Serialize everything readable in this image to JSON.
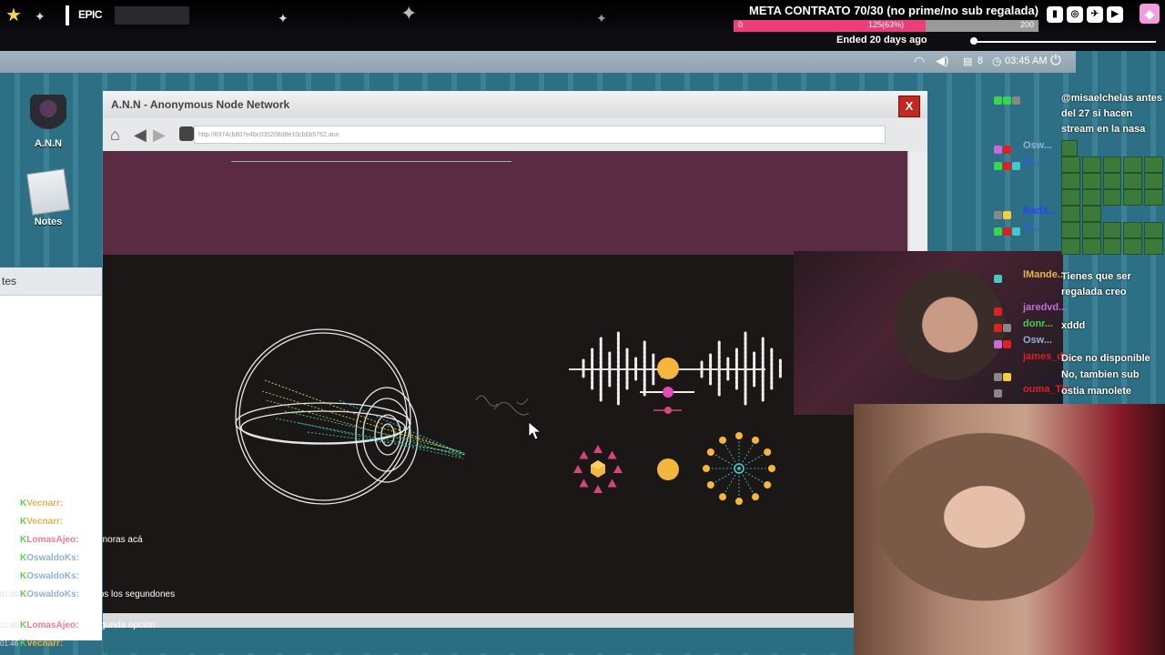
{
  "overlay": {
    "epic_label": "EPIC",
    "goal": {
      "title": "META CONTRATO 70/30 (no prime/no sub regalada)",
      "min": "0",
      "max": "200",
      "center": "125(63%)",
      "progress": 0.63,
      "fill_color": "#ec3f7a"
    },
    "ended": "Ended 20 days ago",
    "social_icons": [
      "twitch-icon",
      "instagram-icon",
      "twitter-icon",
      "youtube-icon"
    ],
    "gem_icon": "gem-icon"
  },
  "taskbar": {
    "badge": "8",
    "clock": "03:45 AM"
  },
  "desktop": {
    "icons": [
      {
        "label": "A.N.N",
        "icon": "hacker-icon"
      },
      {
        "label": "Notes",
        "icon": "notes-icon"
      }
    ],
    "notes_panel_title": "tes"
  },
  "ann": {
    "title": "A.N.N - Anonymous Node Network",
    "close": "X",
    "url": "http://6974cb807e4bc035208d8e10cb6b5762.ann"
  },
  "chat_right": [
    {
      "user": "",
      "user_color": "#3bd44f",
      "message": "@misaelchelas antes del 27 si hacen stream en la nasa"
    },
    {
      "user": "Osw...",
      "user_color": "#8fb2d6",
      "message": ""
    },
    {
      "user": "Ni...",
      "user_color": "#2f5fd8",
      "message": ""
    },
    {
      "user": "BadX...",
      "user_color": "#2a44ff",
      "message": ""
    },
    {
      "user": "Ni...",
      "user_color": "#2f5fd8",
      "message": ""
    },
    {
      "user": "lMande...",
      "user_color": "#e8b24a",
      "message": "Tienes que ser regalada creo"
    },
    {
      "user": "jaredvd...",
      "user_color": "#c86ad8",
      "message": ""
    },
    {
      "user": "donr...",
      "user_color": "#3bd44f",
      "message": "xddd"
    },
    {
      "user": "Osw...",
      "user_color": "#8fb2d6",
      "message": ""
    },
    {
      "user": "james_do...",
      "user_color": "#e02020",
      "message": "Dice no disponible"
    },
    {
      "user": "",
      "user_color": "#2a44ff",
      "message": "No, tambien sub"
    },
    {
      "user": "ouma_Tip",
      "user_color": "#e02020",
      "message": "ostia manolete"
    }
  ],
  "chat_left": [
    {
      "time": "",
      "user": "Vecnarr:",
      "user_color": "#e8b24a",
      "message": ""
    },
    {
      "time": "",
      "user": "Vecnarr:",
      "user_color": "#e8b24a",
      "message": ""
    },
    {
      "time": "",
      "user": "LomasAjeo:",
      "user_color": "#f07a9a",
      "message": "los ignoras acá"
    },
    {
      "time": "",
      "user": "OswaldoKs:",
      "user_color": "#8fb2d6",
      "message": ""
    },
    {
      "time": "",
      "user": "OswaldoKs:",
      "user_color": "#8fb2d6",
      "message": ""
    },
    {
      "time": "01:45",
      "user": "OswaldoKs:",
      "user_color": "#8fb2d6",
      "message": "somos los segundones"
    },
    {
      "time": "01:45",
      "user": "LomasAjeo:",
      "user_color": "#f07a9a",
      "message": "la segunda opcion"
    },
    {
      "time": "01:46",
      "user": "Vecnarr:",
      "user_color": "#e8b24a",
      "message": ""
    }
  ]
}
